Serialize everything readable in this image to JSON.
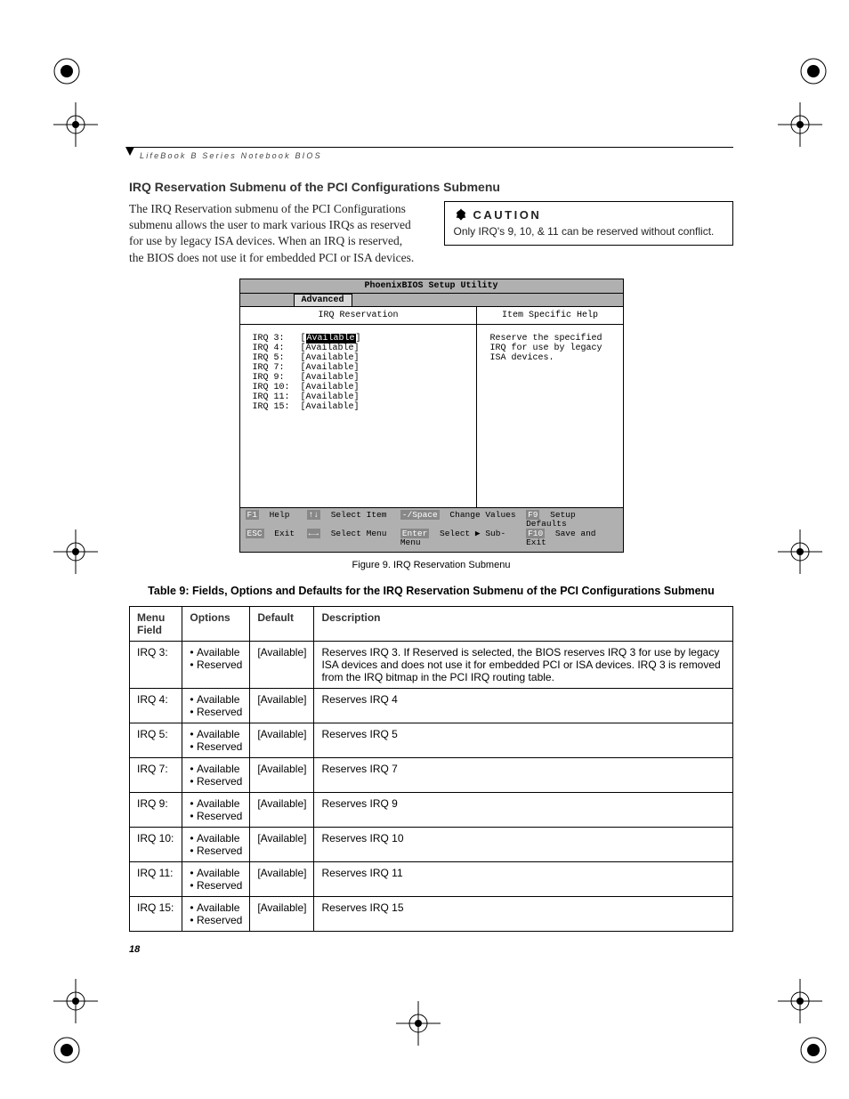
{
  "running_head": "LifeBook B Series Notebook BIOS",
  "section_title": "IRQ Reservation Submenu of the PCI Configurations Submenu",
  "intro_para": "The IRQ Reservation submenu of the PCI Configurations submenu allows the user to mark various IRQs as reserved for use by legacy ISA devices. When an IRQ is reserved, the BIOS does not use it for embedded PCI or ISA devices.",
  "caution": {
    "label": "CAUTION",
    "text": "Only IRQ's 9, 10, & 11 can be reserved without conflict."
  },
  "bios": {
    "title": "PhoenixBIOS Setup Utility",
    "tab": "Advanced",
    "left_title": "IRQ Reservation",
    "right_title": "Item Specific Help",
    "help_text": "Reserve the specified IRQ for use by legacy ISA devices.",
    "items": [
      {
        "label": "IRQ 3:",
        "value": "Available",
        "selected": true
      },
      {
        "label": "IRQ 4:",
        "value": "Available",
        "selected": false
      },
      {
        "label": "IRQ 5:",
        "value": "Available",
        "selected": false
      },
      {
        "label": "IRQ 7:",
        "value": "Available",
        "selected": false
      },
      {
        "label": "IRQ 9:",
        "value": "Available",
        "selected": false
      },
      {
        "label": "IRQ 10:",
        "value": "Available",
        "selected": false
      },
      {
        "label": "IRQ 11:",
        "value": "Available",
        "selected": false
      },
      {
        "label": "IRQ 15:",
        "value": "Available",
        "selected": false
      }
    ],
    "footer": {
      "row1": [
        {
          "key": "F1",
          "text": "Help"
        },
        {
          "key": "↑↓",
          "text": "Select Item"
        },
        {
          "key": "-/Space",
          "text": "Change Values"
        },
        {
          "key": "F9",
          "text": "Setup Defaults"
        }
      ],
      "row2": [
        {
          "key": "ESC",
          "text": "Exit"
        },
        {
          "key": "←→",
          "text": "Select Menu"
        },
        {
          "key": "Enter",
          "text": "Select ▶ Sub-Menu"
        },
        {
          "key": "F10",
          "text": "Save and Exit"
        }
      ]
    }
  },
  "figure_caption": "Figure 9.  IRQ Reservation Submenu",
  "table_title": "Table 9: Fields, Options and Defaults for the IRQ Reservation Submenu of the PCI Configurations Submenu",
  "table": {
    "headers": [
      "Menu Field",
      "Options",
      "Default",
      "Description"
    ],
    "option_bullets": [
      "Available",
      "Reserved"
    ],
    "rows": [
      {
        "field": "IRQ 3:",
        "default": "[Available]",
        "desc": "Reserves IRQ 3. If Reserved is selected, the BIOS reserves IRQ 3 for use by legacy ISA devices and does not use it for embedded PCI or ISA devices. IRQ 3 is removed from the IRQ bitmap in the PCI IRQ routing table."
      },
      {
        "field": "IRQ 4:",
        "default": "[Available]",
        "desc": "Reserves IRQ 4"
      },
      {
        "field": "IRQ 5:",
        "default": "[Available]",
        "desc": "Reserves IRQ 5"
      },
      {
        "field": "IRQ 7:",
        "default": "[Available]",
        "desc": "Reserves IRQ 7"
      },
      {
        "field": "IRQ 9:",
        "default": "[Available]",
        "desc": "Reserves IRQ 9"
      },
      {
        "field": "IRQ 10:",
        "default": "[Available]",
        "desc": "Reserves IRQ 10"
      },
      {
        "field": "IRQ 11:",
        "default": "[Available]",
        "desc": "Reserves IRQ 11"
      },
      {
        "field": "IRQ 15:",
        "default": "[Available]",
        "desc": "Reserves IRQ 15"
      }
    ]
  },
  "page_number": "18"
}
